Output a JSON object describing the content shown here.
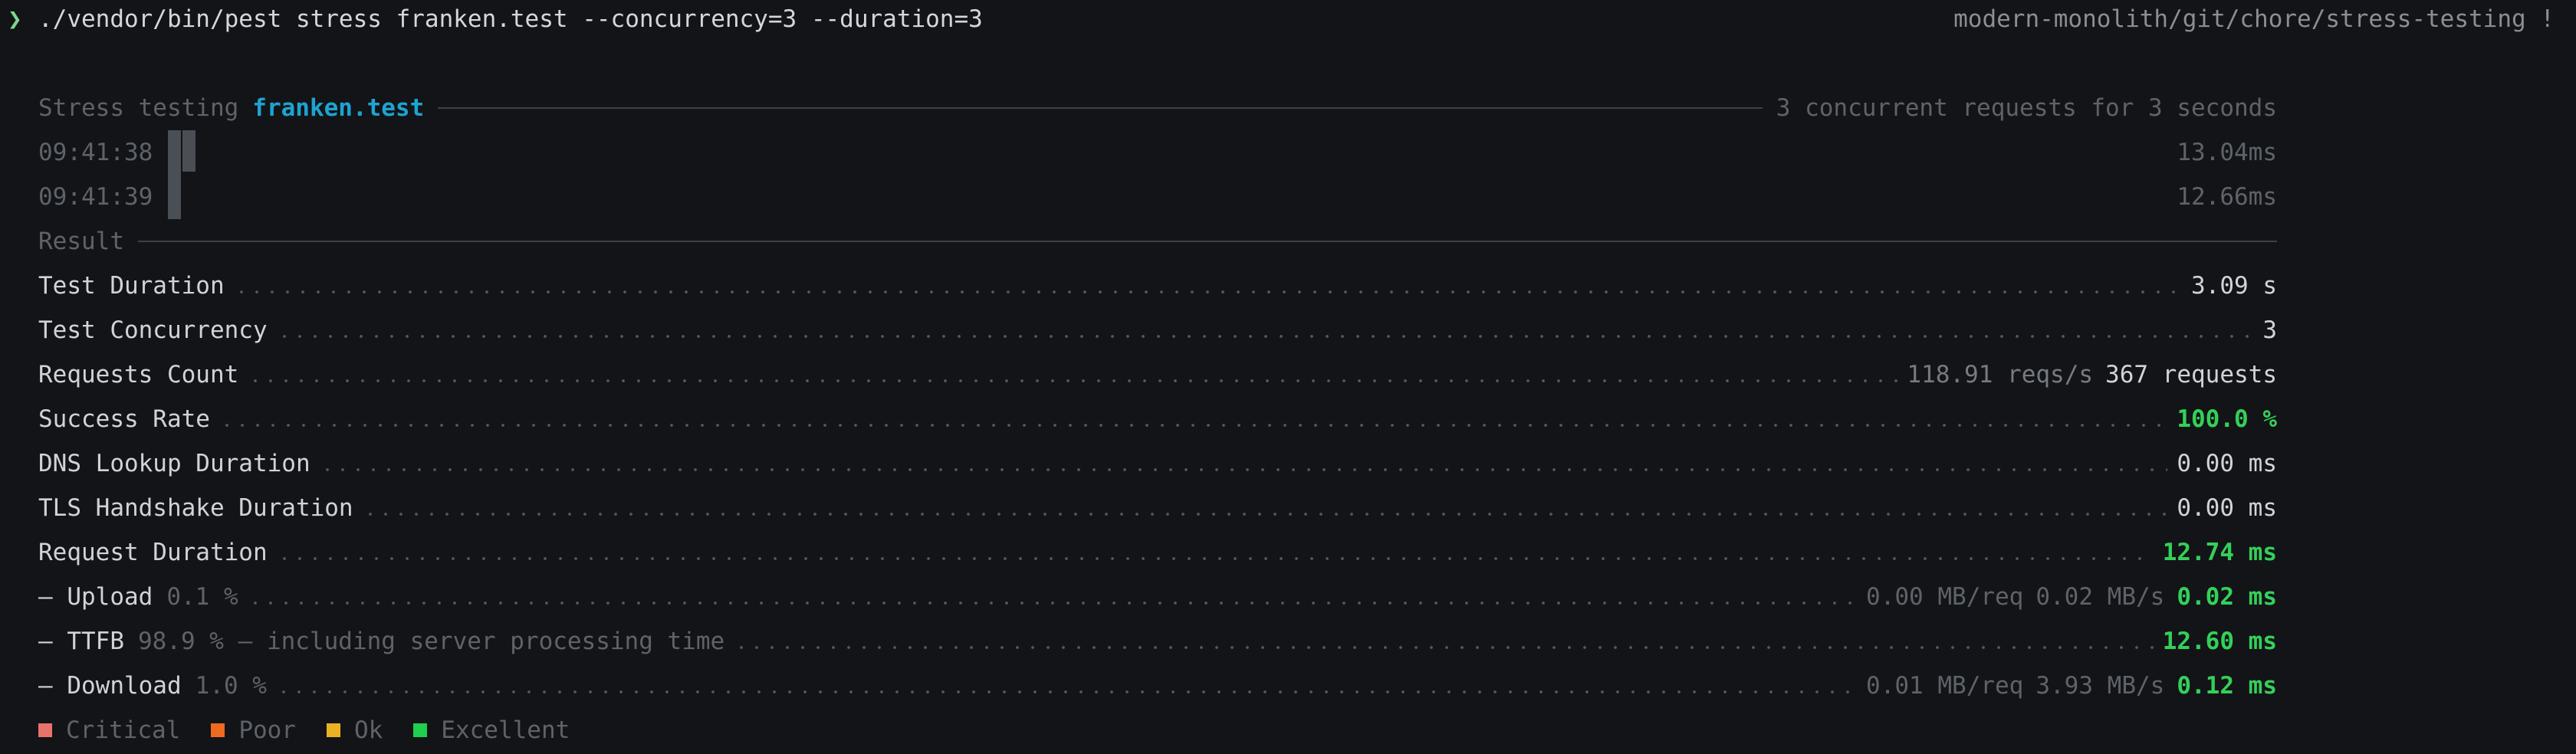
{
  "prompt": {
    "caret": "❯",
    "command": "./vendor/bin/pest stress franken.test --concurrency=3 --duration=3",
    "context": "modern-monolith/git/chore/stress-testing !"
  },
  "header": {
    "prefix": "Stress testing",
    "target": "franken.test",
    "summary": "3 concurrent requests for 3 seconds"
  },
  "timings": [
    {
      "time": "09:41:38",
      "value": "13.04ms"
    },
    {
      "time": "09:41:39",
      "value": "12.66ms"
    }
  ],
  "result_label": "Result",
  "metrics": {
    "duration": {
      "label": "Test Duration",
      "value": "3.09 s"
    },
    "concurrency": {
      "label": "Test Concurrency",
      "value": "3"
    },
    "requests": {
      "label": "Requests Count",
      "rate": "118.91 reqs/s",
      "value": "367 requests"
    },
    "success": {
      "label": "Success Rate",
      "value": "100.0 %"
    },
    "dns": {
      "label": "DNS Lookup Duration",
      "value": "0.00 ms"
    },
    "tls": {
      "label": "TLS Handshake Duration",
      "value": "0.00 ms"
    },
    "request_duration": {
      "label": "Request Duration",
      "value": "12.74 ms"
    },
    "upload": {
      "label": "— Upload",
      "pct": "0.1 %",
      "size": "0.00 MB/req",
      "speed": "0.02 MB/s",
      "value": "0.02 ms"
    },
    "ttfb": {
      "label": "— TTFB",
      "pct": "98.9 % — including server processing time",
      "value": "12.60 ms"
    },
    "download": {
      "label": "— Download",
      "pct": "1.0 %",
      "size": "0.01 MB/req",
      "speed": "3.93 MB/s",
      "value": "0.12 ms"
    }
  },
  "legend": [
    {
      "label": "Critical",
      "color": "#e8736b"
    },
    {
      "label": "Poor",
      "color": "#ee6a1f"
    },
    {
      "label": "Ok",
      "color": "#e8b223"
    },
    {
      "label": "Excellent",
      "color": "#1fcf4f"
    }
  ]
}
